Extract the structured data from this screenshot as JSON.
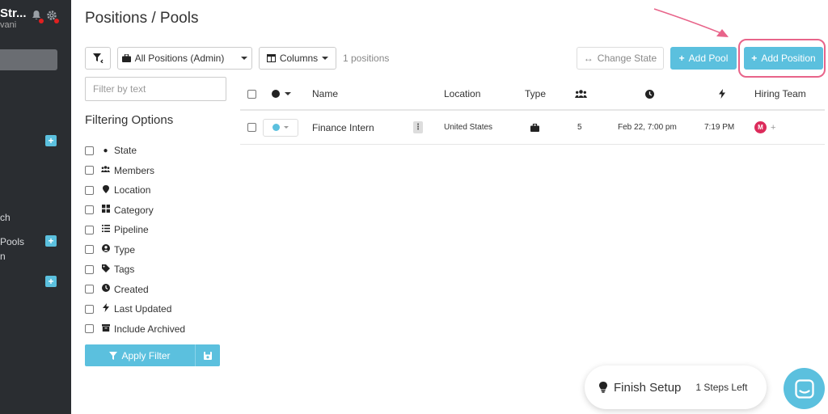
{
  "sidebar": {
    "org_name": "Str...",
    "org_sub": "vani",
    "items": [
      {
        "label": "ch"
      },
      {
        "label": "Pools"
      },
      {
        "label": "n"
      }
    ]
  },
  "page": {
    "title": "Positions / Pools"
  },
  "toolbar": {
    "view_select": "All Positions (Admin)",
    "columns_label": "Columns",
    "count_text": "1 positions",
    "change_state_label": "Change State",
    "add_pool_label": "Add Pool",
    "add_position_label": "Add Position"
  },
  "filters": {
    "search_placeholder": "Filter by text",
    "heading": "Filtering Options",
    "options": [
      {
        "label": "State",
        "icon": "circle-icon"
      },
      {
        "label": "Members",
        "icon": "users-icon"
      },
      {
        "label": "Location",
        "icon": "map-pin-icon"
      },
      {
        "label": "Category",
        "icon": "grid-icon"
      },
      {
        "label": "Pipeline",
        "icon": "list-icon"
      },
      {
        "label": "Type",
        "icon": "user-circle-icon"
      },
      {
        "label": "Tags",
        "icon": "tag-icon"
      },
      {
        "label": "Created",
        "icon": "clock-icon"
      },
      {
        "label": "Last Updated",
        "icon": "bolt-icon"
      },
      {
        "label": "Include Archived",
        "icon": "archive-icon"
      }
    ],
    "apply_label": "Apply Filter"
  },
  "table": {
    "headers": {
      "name": "Name",
      "location": "Location",
      "type": "Type",
      "hiring_team": "Hiring Team"
    },
    "rows": [
      {
        "name": "Finance Intern",
        "location": "United States",
        "members": "5",
        "created": "Feb 22, 7:00 pm",
        "updated": "7:19 PM",
        "avatar": "M"
      }
    ]
  },
  "finish_setup": {
    "label": "Finish Setup",
    "steps_left": "1 Steps Left"
  },
  "colors": {
    "accent": "#5bc0de",
    "sidebar_bg": "#2a2d31",
    "highlight": "#e8648a",
    "avatar": "#dc2b5b"
  }
}
